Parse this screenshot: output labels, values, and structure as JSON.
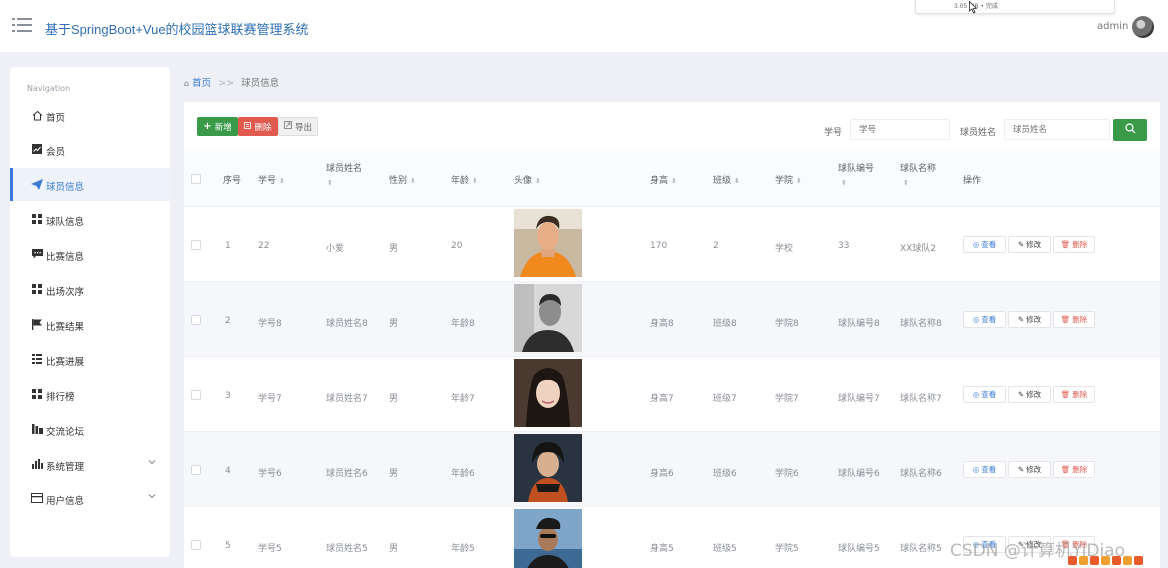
{
  "header": {
    "title": "基于SpringBoot+Vue的校园篮球联赛管理系统",
    "user": "admin",
    "download_status": "3.05 MB • 完成"
  },
  "sidebar": {
    "label": "Navigation",
    "items": [
      {
        "label": "首页",
        "icon": "home-icon"
      },
      {
        "label": "会员",
        "icon": "chart-icon"
      },
      {
        "label": "球员信息",
        "icon": "paper-plane-icon",
        "active": true
      },
      {
        "label": "球队信息",
        "icon": "grid-icon"
      },
      {
        "label": "比赛信息",
        "icon": "message-icon"
      },
      {
        "label": "出场次序",
        "icon": "grid-icon"
      },
      {
        "label": "比赛结果",
        "icon": "flag-icon"
      },
      {
        "label": "比赛进展",
        "icon": "list-icon"
      },
      {
        "label": "排行榜",
        "icon": "grid-icon"
      },
      {
        "label": "交流论坛",
        "icon": "bar-icon"
      },
      {
        "label": "系统管理",
        "icon": "stats-icon",
        "expandable": true
      },
      {
        "label": "用户信息",
        "icon": "card-icon",
        "expandable": true
      }
    ]
  },
  "breadcrumb": {
    "home": "首页",
    "separator": ">>",
    "current": "球员信息"
  },
  "toolbar": {
    "add_label": "新增",
    "delete_label": "删除",
    "export_label": "导出",
    "search_id_label": "学号",
    "search_id_placeholder": "学号",
    "search_name_label": "球员姓名",
    "search_name_placeholder": "球员姓名"
  },
  "table": {
    "headers": {
      "index": "序号",
      "id": "学号",
      "name": "球员姓名",
      "gender": "性别",
      "age": "年龄",
      "photo": "头像",
      "height": "身高",
      "class": "班级",
      "college": "学院",
      "team_no": "球队编号",
      "team_name": "球队名称",
      "actions": "操作"
    },
    "action_labels": {
      "view": "查看",
      "edit": "修改",
      "delete": "删除"
    },
    "rows": [
      {
        "index": "1",
        "id": "22",
        "name": "小爱",
        "gender": "男",
        "age": "20",
        "height": "170",
        "class": "2",
        "college": "学校",
        "team_no": "33",
        "team_name": "XX球队2"
      },
      {
        "index": "2",
        "id": "学号8",
        "name": "球员姓名8",
        "gender": "男",
        "age": "年龄8",
        "height": "身高8",
        "class": "班级8",
        "college": "学院8",
        "team_no": "球队编号8",
        "team_name": "球队名称8"
      },
      {
        "index": "3",
        "id": "学号7",
        "name": "球员姓名7",
        "gender": "男",
        "age": "年龄7",
        "height": "身高7",
        "class": "班级7",
        "college": "学院7",
        "team_no": "球队编号7",
        "team_name": "球队名称7"
      },
      {
        "index": "4",
        "id": "学号6",
        "name": "球员姓名6",
        "gender": "男",
        "age": "年龄6",
        "height": "身高6",
        "class": "班级6",
        "college": "学院6",
        "team_no": "球队编号6",
        "team_name": "球队名称6"
      },
      {
        "index": "5",
        "id": "学号5",
        "name": "球员姓名5",
        "gender": "男",
        "age": "年龄5",
        "height": "身高5",
        "class": "班级5",
        "college": "学院5",
        "team_no": "球队编号5",
        "team_name": "球队名称5"
      }
    ]
  },
  "watermark": "CSDN @计算机YiDiao",
  "colors": {
    "primary": "#3a7bd5",
    "success": "#3b9a4a",
    "danger": "#e05a4f"
  }
}
